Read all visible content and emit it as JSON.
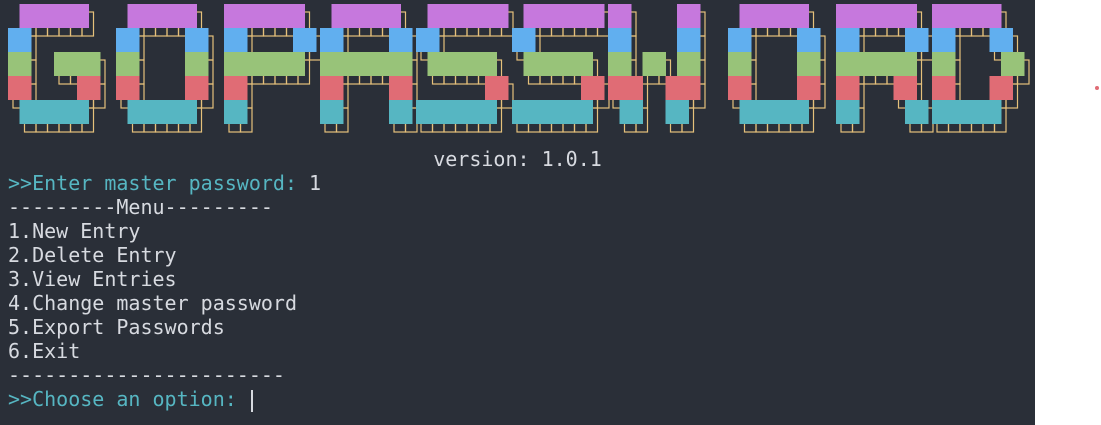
{
  "banner": {
    "art": "GOPASSWORD",
    "colors": {
      "purple": "#c678dd",
      "blue": "#61afef",
      "green": "#98c379",
      "red": "#e06c75",
      "cyan": "#56b6c2",
      "shadow": "#e5c07b"
    }
  },
  "terminal": {
    "background": "#2a2f38",
    "prompt_color": "#56b6c2",
    "version": "version: 1.0.1",
    "master_prompt": ">>Enter master password: ",
    "master_value": "1",
    "menu_header": "---------Menu---------",
    "menu_items": [
      "1.New Entry",
      "2.Delete Entry",
      "3.View Entries",
      "4.Change master password",
      "5.Export Passwords",
      "6.Exit"
    ],
    "menu_footer": "-----------------------",
    "choose_prompt": ">>Choose an option: ",
    "choose_value": ""
  }
}
